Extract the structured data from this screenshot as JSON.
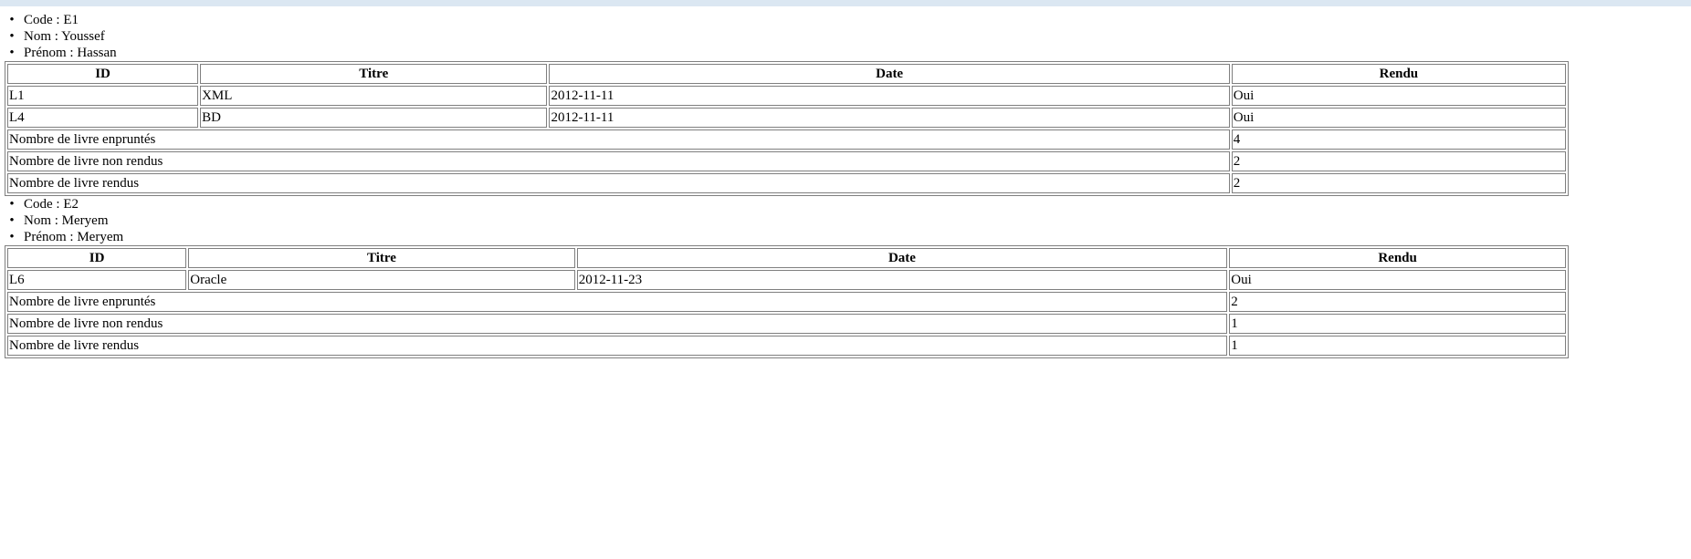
{
  "students": [
    {
      "info": {
        "code": "Code : E1",
        "nom": "Nom : Youssef",
        "prenom": "Prénom : Hassan"
      },
      "headers": {
        "id": "ID",
        "titre": "Titre",
        "date": "Date",
        "rendu": "Rendu"
      },
      "rows": [
        {
          "id": "L1",
          "titre": "XML",
          "date": "2012-11-11",
          "rendu": "Oui"
        },
        {
          "id": "L4",
          "titre": "BD",
          "date": "2012-11-11",
          "rendu": "Oui"
        }
      ],
      "summary": [
        {
          "label": "Nombre de livre enpruntés",
          "value": "4"
        },
        {
          "label": "Nombre de livre non rendus",
          "value": "2"
        },
        {
          "label": "Nombre de livre rendus",
          "value": "2"
        }
      ]
    },
    {
      "info": {
        "code": "Code : E2",
        "nom": "Nom : Meryem",
        "prenom": "Prénom : Meryem"
      },
      "headers": {
        "id": "ID",
        "titre": "Titre",
        "date": "Date",
        "rendu": "Rendu"
      },
      "rows": [
        {
          "id": "L6",
          "titre": "Oracle",
          "date": "2012-11-23",
          "rendu": "Oui"
        }
      ],
      "summary": [
        {
          "label": "Nombre de livre enpruntés",
          "value": "2"
        },
        {
          "label": "Nombre de livre non rendus",
          "value": "1"
        },
        {
          "label": "Nombre de livre rendus",
          "value": "1"
        }
      ]
    }
  ]
}
